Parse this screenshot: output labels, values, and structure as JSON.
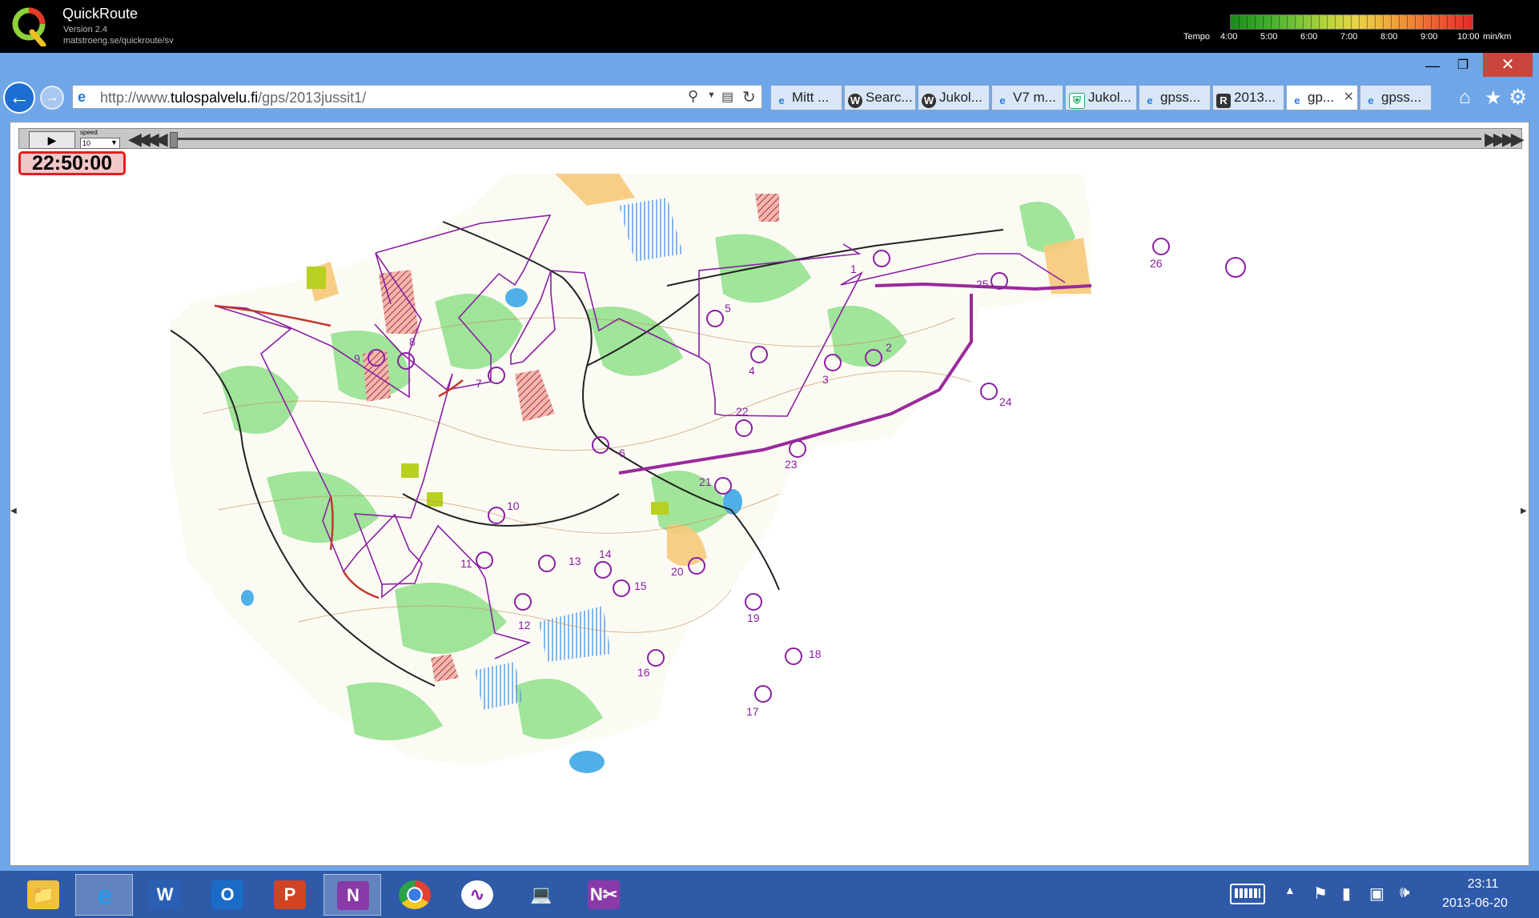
{
  "app": {
    "title": "QuickRoute",
    "version": "Version 2.4",
    "url": "matstroeng.se/quickroute/sv"
  },
  "tempo": {
    "label": "Tempo",
    "ticks": [
      "4:00",
      "5:00",
      "6:00",
      "7:00",
      "8:00",
      "9:00",
      "10:00"
    ],
    "unit": "min/km"
  },
  "browser": {
    "address_prefix": "http://www.",
    "address_domain": "tulospalvelu.fi",
    "address_suffix": "/gps/2013jussit1/",
    "tabs": [
      {
        "label": "Mitt ...",
        "icon": "ie-icon"
      },
      {
        "label": "Searc...",
        "icon": "w-icon"
      },
      {
        "label": "Jukol...",
        "icon": "w-icon"
      },
      {
        "label": "V7 m...",
        "icon": "ie-icon"
      },
      {
        "label": "Jukol...",
        "icon": "shield-icon"
      },
      {
        "label": "gpss...",
        "icon": "ie-icon"
      },
      {
        "label": "2013...",
        "icon": "r-icon"
      },
      {
        "label": "gp...",
        "icon": "ie-icon",
        "active": true
      },
      {
        "label": "gpss...",
        "icon": "ie-icon"
      }
    ]
  },
  "player": {
    "play": "▶",
    "speed_label": "speed",
    "speed_value": "10",
    "clock": "22:50:00"
  },
  "map": {
    "controls": [
      "1",
      "2",
      "3",
      "4",
      "5",
      "6",
      "7",
      "8",
      "9",
      "10",
      "11",
      "12",
      "13",
      "14",
      "15",
      "16",
      "17",
      "18",
      "19",
      "20",
      "21",
      "22",
      "23",
      "24",
      "25",
      "26"
    ]
  },
  "taskbar": {
    "apps": [
      "file-explorer-icon",
      "internet-explorer-icon",
      "word-icon",
      "outlook-icon",
      "powerpoint-icon",
      "onenote-icon",
      "chrome-icon",
      "quickroute-icon",
      "laptop-icon",
      "onenote-clipper-icon"
    ],
    "time": "23:11",
    "date": "2013-06-20"
  }
}
